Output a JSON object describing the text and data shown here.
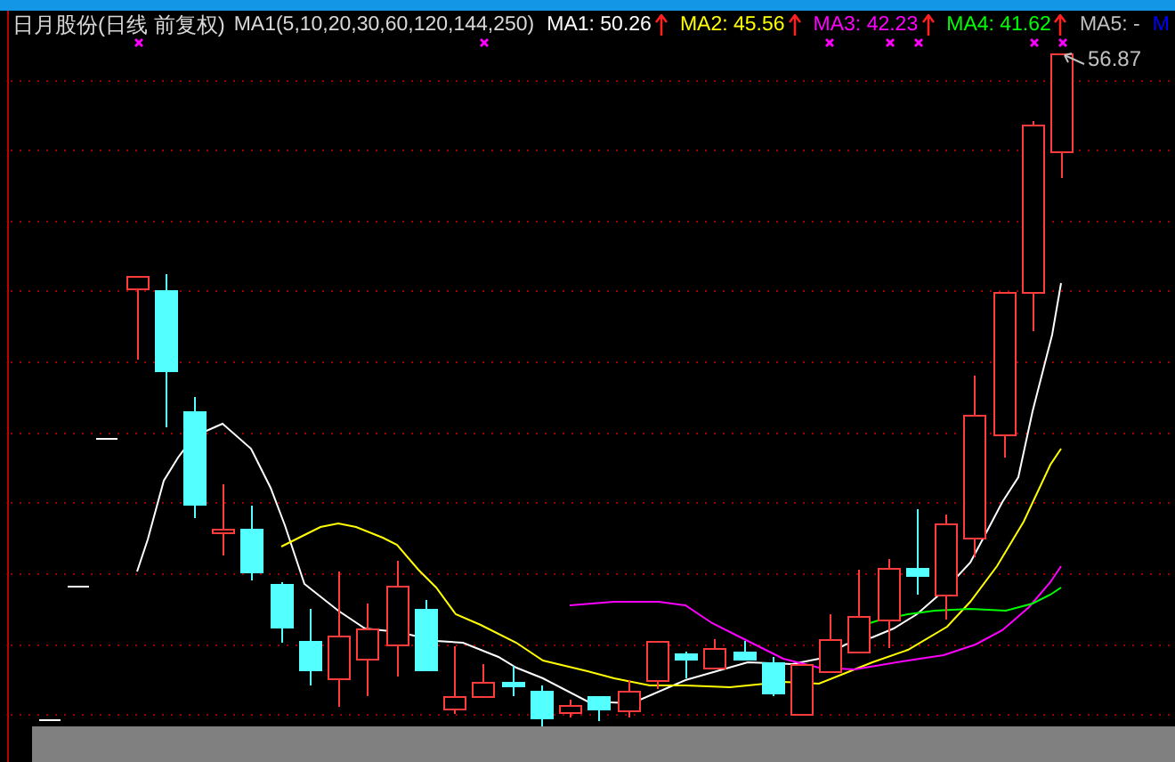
{
  "title": "日月股份(日线 前复权)",
  "formula": "MA1(5,10,20,30,60,120,144,250)",
  "indicators": [
    {
      "label": "MA1: 50.26",
      "color": "#ffffff",
      "rising": true
    },
    {
      "label": "MA2: 45.56",
      "color": "#ffff00",
      "rising": true
    },
    {
      "label": "MA3: 42.23",
      "color": "#ff00ff",
      "rising": true
    },
    {
      "label": "MA4: 41.62",
      "color": "#00ff00",
      "rising": true
    },
    {
      "label": "MA5: -",
      "color": "#c0c0c0",
      "rising": false
    },
    {
      "label": "M",
      "color": "#0000ff",
      "rising": false
    }
  ],
  "price_label": "56.87"
}
